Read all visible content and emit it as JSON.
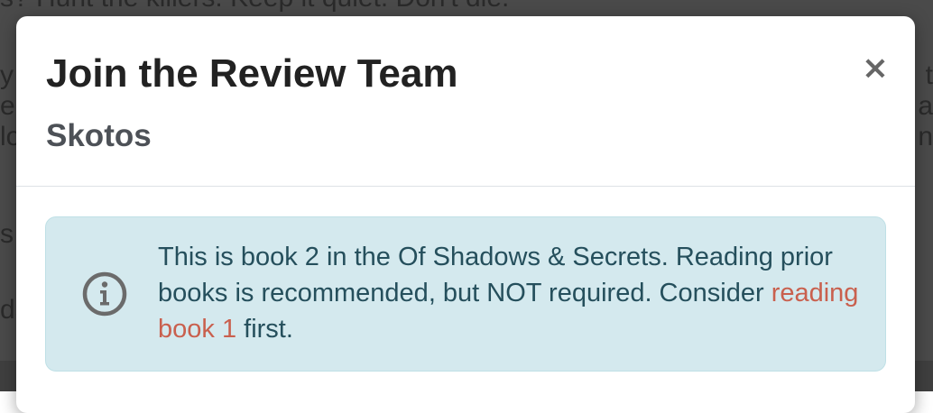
{
  "background": {
    "lines": [
      "s? Hunt the killers. Keep it quiet. Don't die.",
      "y",
      "e",
      "lo",
      "s",
      "da"
    ],
    "right": [
      "t",
      "a",
      "n"
    ]
  },
  "modal": {
    "title": "Join the Review Team",
    "subtitle": "Skotos",
    "close_label": "×"
  },
  "alert": {
    "icon": "info-circle-icon",
    "text_before": "This is book 2 in the Of Shadows & Secrets. Reading prior books is recommended, but NOT required. Consider ",
    "link_text": "reading book 1",
    "text_after": " first."
  },
  "colors": {
    "alert_bg": "#d4e9ee",
    "alert_text": "#254f5c",
    "link": "#c9604e",
    "icon": "#6b6b6b"
  }
}
